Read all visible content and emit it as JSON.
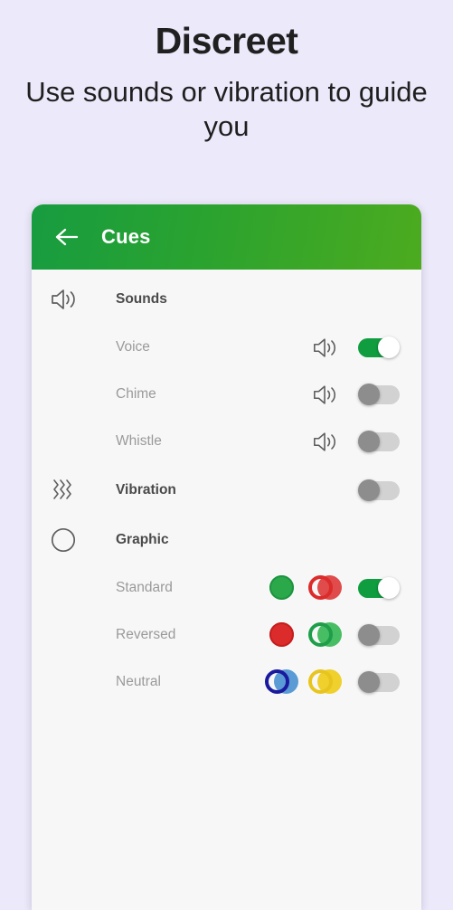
{
  "promo": {
    "title": "Discreet",
    "subtitle": "Use sounds or vibration to guide you"
  },
  "appbar": {
    "back_icon": "arrow-left-icon",
    "title": "Cues",
    "gradient_from": "#179C40",
    "gradient_to": "#4CAB1F"
  },
  "colors": {
    "page_background": "#ECE9FA",
    "card_background": "#F7F7F7",
    "toggle_on": "#0F9D3F",
    "toggle_off_track": "#D2D2D2",
    "toggle_off_knob": "#8D8D8D",
    "section_label": "#4A4A4A",
    "item_label": "#9A9A9A",
    "green": "#2BA84A",
    "red": "#DC2B2B",
    "blue_ring": "#1A1A9E",
    "blue_fill": "#5B9BD5",
    "yellow": "#E8C51E"
  },
  "sections": [
    {
      "id": "sounds",
      "icon": "speaker-icon",
      "label": "Sounds",
      "items": [
        {
          "id": "voice",
          "label": "Voice",
          "trailing_icon": "speaker-icon",
          "toggle": "on"
        },
        {
          "id": "chime",
          "label": "Chime",
          "trailing_icon": "speaker-icon",
          "toggle": "off"
        },
        {
          "id": "whistle",
          "label": "Whistle",
          "trailing_icon": "speaker-icon",
          "toggle": "off"
        }
      ]
    },
    {
      "id": "vibration",
      "icon": "vibration-icon",
      "label": "Vibration",
      "toggle": "off",
      "items": []
    },
    {
      "id": "graphic",
      "icon": "circle-outline-icon",
      "label": "Graphic",
      "items": [
        {
          "id": "standard",
          "label": "Standard",
          "toggle": "on",
          "graphics": [
            {
              "style": "single-disc",
              "color": "#2BA84A"
            },
            {
              "style": "ring-and-disc",
              "ring_color": "#DC2B2B",
              "disc_color": "#E04B4B"
            }
          ]
        },
        {
          "id": "reversed",
          "label": "Reversed",
          "toggle": "off",
          "graphics": [
            {
              "style": "single-disc",
              "color": "#DC2B2B"
            },
            {
              "style": "ring-and-disc",
              "ring_color": "#1E9E4A",
              "disc_color": "#47BE63"
            }
          ]
        },
        {
          "id": "neutral",
          "label": "Neutral",
          "toggle": "off",
          "graphics": [
            {
              "style": "ring-and-disc",
              "ring_color": "#1A1A9E",
              "disc_color": "#5B9BD5"
            },
            {
              "style": "ring-and-disc",
              "ring_color": "#E8C51E",
              "disc_color": "#EFD02C"
            }
          ]
        }
      ]
    }
  ]
}
